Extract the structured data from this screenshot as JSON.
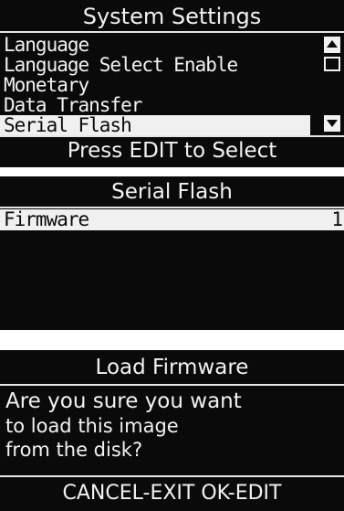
{
  "system_settings": {
    "title": "System Settings",
    "items": [
      {
        "label": "Language"
      },
      {
        "label": "Language Select Enable"
      },
      {
        "label": "Monetary"
      },
      {
        "label": "Data Transfer"
      },
      {
        "label": "Serial Flash"
      }
    ],
    "selected_label": "Serial Flash",
    "footer": "Press EDIT to Select",
    "scroll_up_icon": "triangle-up-icon",
    "scroll_down_icon": "triangle-down-icon"
  },
  "serial_flash": {
    "title": "Serial Flash",
    "items": [
      {
        "label": "Firmware",
        "value": "1"
      }
    ],
    "selected_label": "Firmware"
  },
  "load_firmware": {
    "title": "Load Firmware",
    "message_lines": [
      "Are you sure you want",
      "to load this image",
      "from the disk?"
    ],
    "footer": "CANCEL-EXIT OK-EDIT"
  },
  "colors": {
    "screen_bg": "#0a0a0a",
    "text": "#f2f2f2",
    "highlight_bg": "#f0f0f0",
    "highlight_text": "#0a0a0a"
  }
}
